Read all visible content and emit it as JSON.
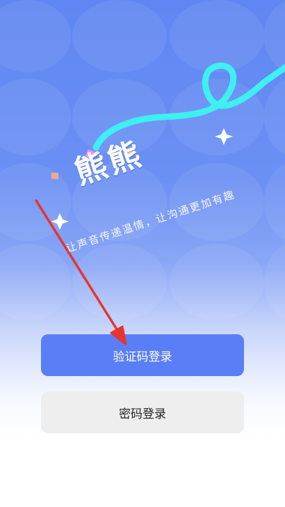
{
  "hero": {
    "title": "熊熊",
    "slogan": "让声音传递温情，让沟通更加有趣"
  },
  "actions": {
    "sms_login_label": "验证码登录",
    "password_login_label": "密码登录"
  },
  "colors": {
    "primary": "#5a7ef5",
    "secondary": "#eeeeee",
    "ribbon": "#3ef0f0",
    "arrow": "#e8332e"
  }
}
